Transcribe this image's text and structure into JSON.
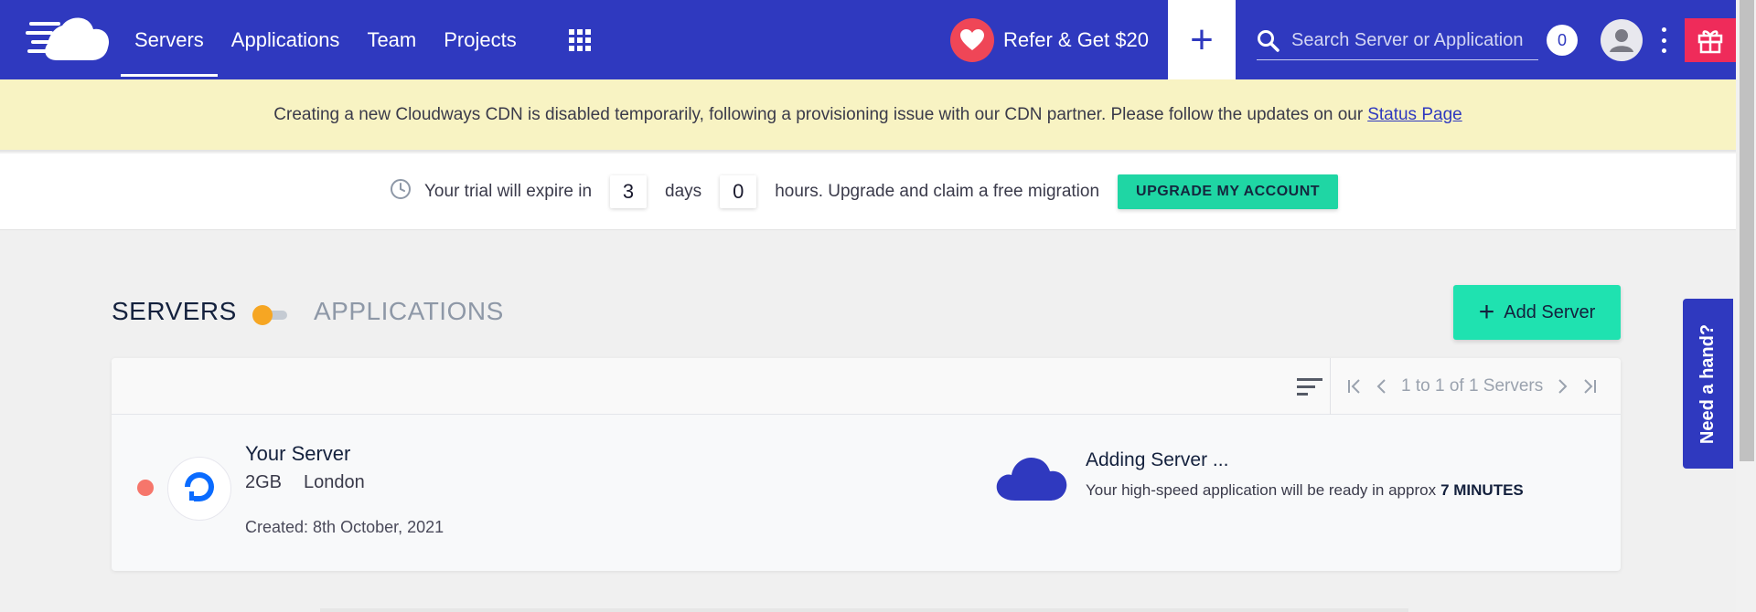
{
  "nav": {
    "items": [
      {
        "label": "Servers",
        "active": true
      },
      {
        "label": "Applications",
        "active": false
      },
      {
        "label": "Team",
        "active": false
      },
      {
        "label": "Projects",
        "active": false
      }
    ],
    "refer_label": "Refer & Get $20",
    "add_label": "+",
    "search_placeholder": "Search Server or Application",
    "notification_count": "0"
  },
  "banner": {
    "message": "Creating a new Cloudways CDN is disabled temporarily, following a provisioning issue with our CDN partner. Please follow the updates on our",
    "link_text": "Status Page"
  },
  "trial": {
    "prefix": "Your trial will expire in",
    "days_value": "3",
    "days_label": "days",
    "hours_value": "0",
    "hours_suffix": "hours. Upgrade and claim a free migration",
    "upgrade_label": "UPGRADE MY ACCOUNT"
  },
  "section": {
    "title": "SERVERS",
    "alt_title": "APPLICATIONS",
    "add_server_label": "Add Server",
    "add_server_plus": "+"
  },
  "pagination": {
    "text": "1 to 1 of 1 Servers"
  },
  "servers": [
    {
      "name": "Your Server",
      "size": "2GB",
      "location": "London",
      "created": "Created: 8th October, 2021",
      "status_color": "#f6766b",
      "progress_title": "Adding Server ...",
      "progress_text": "Your high-speed application will be ready in approx",
      "progress_eta": "7 MINUTES"
    }
  ],
  "help": {
    "label": "Need a hand?"
  },
  "colors": {
    "brand": "#2f39bf",
    "accent": "#1fe2b0",
    "refer": "#ef4657",
    "gift": "#ef2b5a",
    "banner_bg": "#f8f3c3",
    "toggle_knob": "#f6a623"
  }
}
